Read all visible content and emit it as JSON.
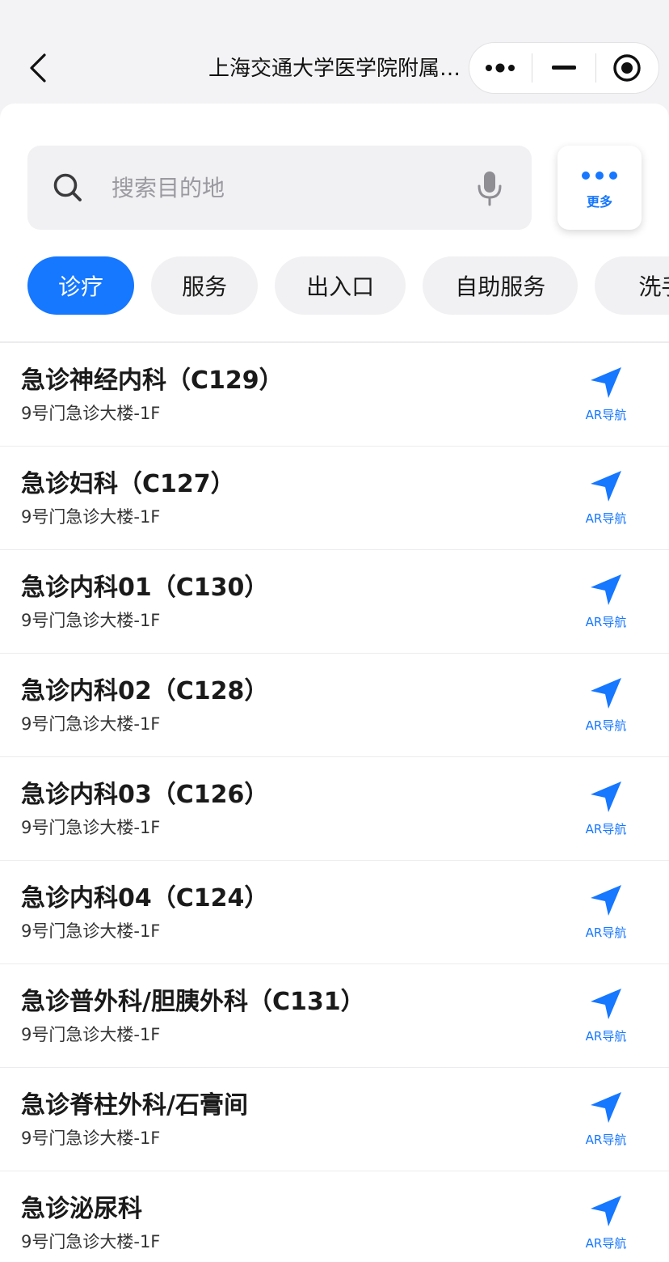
{
  "header": {
    "title": "上海交通大学医学院附属…"
  },
  "capsule": {
    "more_icon": "ellipsis-icon",
    "minimize_icon": "minimize-icon",
    "close_icon": "target-circle-icon"
  },
  "search": {
    "placeholder": "搜索目的地",
    "value": ""
  },
  "more_button": {
    "label": "更多"
  },
  "categories": [
    {
      "label": "诊疗",
      "active": true
    },
    {
      "label": "服务",
      "active": false
    },
    {
      "label": "出入口",
      "active": false
    },
    {
      "label": "自助服务",
      "active": false
    },
    {
      "label": "洗手间",
      "active": false
    }
  ],
  "list": [
    {
      "name": "急诊神经内科（C129）",
      "location": "9号门急诊大楼-1F",
      "action": "AR导航"
    },
    {
      "name": "急诊妇科（C127）",
      "location": "9号门急诊大楼-1F",
      "action": "AR导航"
    },
    {
      "name": "急诊内科01（C130）",
      "location": "9号门急诊大楼-1F",
      "action": "AR导航"
    },
    {
      "name": "急诊内科02（C128）",
      "location": "9号门急诊大楼-1F",
      "action": "AR导航"
    },
    {
      "name": "急诊内科03（C126）",
      "location": "9号门急诊大楼-1F",
      "action": "AR导航"
    },
    {
      "name": "急诊内科04（C124）",
      "location": "9号门急诊大楼-1F",
      "action": "AR导航"
    },
    {
      "name": "急诊普外科/胆胰外科（C131）",
      "location": "9号门急诊大楼-1F",
      "action": "AR导航"
    },
    {
      "name": "急诊脊柱外科/石膏间",
      "location": "9号门急诊大楼-1F",
      "action": "AR导航"
    },
    {
      "name": "急诊泌尿科",
      "location": "9号门急诊大楼-1F",
      "action": "AR导航"
    }
  ],
  "colors": {
    "accent": "#1677ff",
    "chip_bg": "#f1f1f3",
    "text": "#1a1a1a"
  }
}
